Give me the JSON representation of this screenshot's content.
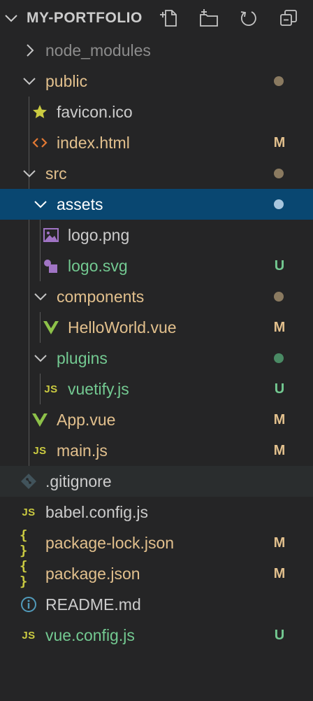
{
  "explorer": {
    "title": "MY-PORTFOLIO",
    "actions": [
      {
        "icon": "new-file-icon"
      },
      {
        "icon": "new-folder-icon"
      },
      {
        "icon": "refresh-icon"
      },
      {
        "icon": "collapse-all-icon"
      }
    ]
  },
  "tree": {
    "node_modules": {
      "label": "node_modules",
      "icon": "chevron-right-icon"
    },
    "public": {
      "label": "public"
    },
    "favicon": {
      "label": "favicon.ico",
      "icon": "star-icon"
    },
    "index_html": {
      "label": "index.html",
      "badge": "M",
      "icon": "html-icon"
    },
    "src": {
      "label": "src"
    },
    "assets": {
      "label": "assets"
    },
    "logo_png": {
      "label": "logo.png",
      "icon": "image-icon"
    },
    "logo_svg": {
      "label": "logo.svg",
      "badge": "U",
      "icon": "svg-icon"
    },
    "components": {
      "label": "components"
    },
    "helloworld": {
      "label": "HelloWorld.vue",
      "badge": "M",
      "icon": "vue-icon"
    },
    "plugins": {
      "label": "plugins"
    },
    "vuetify": {
      "label": "vuetify.js",
      "badge": "U",
      "icon": "js-icon",
      "icon_text": "JS"
    },
    "app_vue": {
      "label": "App.vue",
      "badge": "M",
      "icon": "vue-icon"
    },
    "main_js": {
      "label": "main.js",
      "badge": "M",
      "icon": "js-icon",
      "icon_text": "JS"
    },
    "gitignore": {
      "label": ".gitignore",
      "icon": "git-icon"
    },
    "babel": {
      "label": "babel.config.js",
      "icon": "js-icon",
      "icon_text": "JS"
    },
    "package_lock": {
      "label": "package-lock.json",
      "badge": "M",
      "icon": "json-icon",
      "icon_text": "{ }"
    },
    "package_json": {
      "label": "package.json",
      "badge": "M",
      "icon": "json-icon",
      "icon_text": "{ }"
    },
    "readme": {
      "label": "README.md",
      "icon": "info-icon"
    },
    "vue_config": {
      "label": "vue.config.js",
      "badge": "U",
      "icon": "js-icon",
      "icon_text": "JS"
    }
  },
  "colors": {
    "background": "#252526",
    "selected": "#094771",
    "modified": "#e2c08d",
    "untracked": "#73c991",
    "ignored": "#8c8c8c",
    "default_text": "#cccccc",
    "folder_dot": "#8a7a60",
    "untracked_dot": "#4a8a64",
    "selected_dot": "#a8c6de"
  }
}
